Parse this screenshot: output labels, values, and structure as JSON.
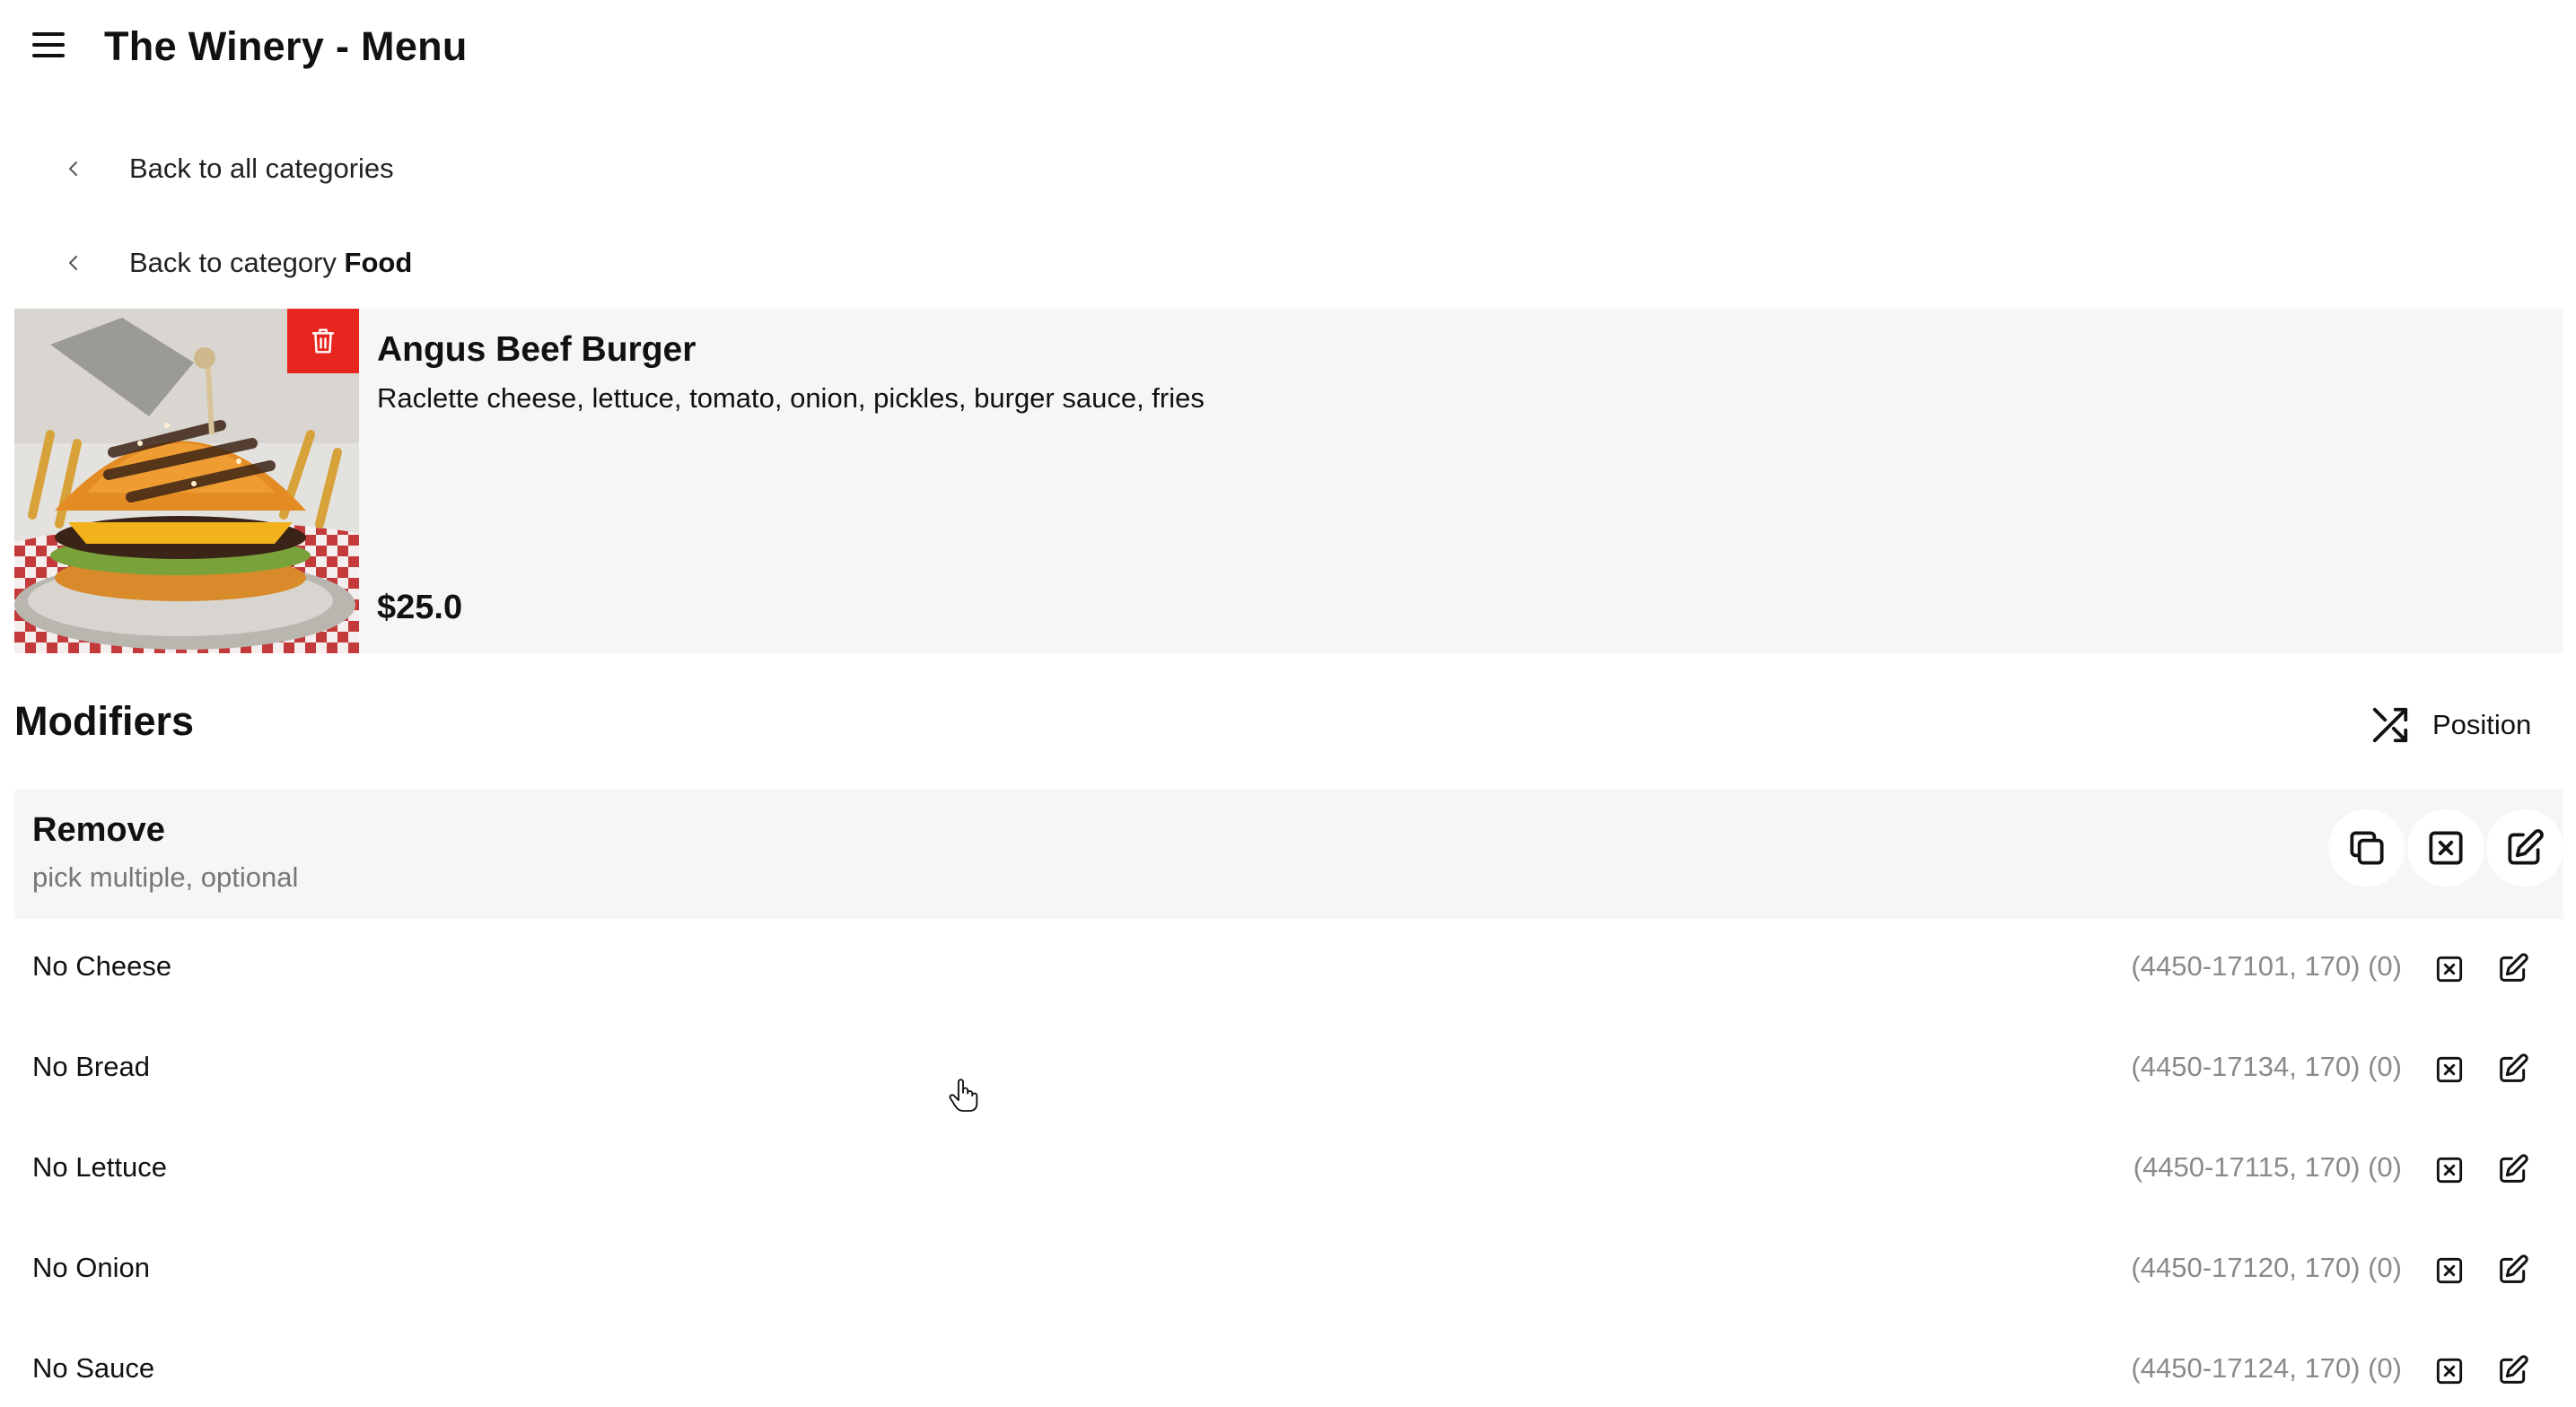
{
  "header": {
    "title": "The Winery - Menu",
    "menu_icon": "hamburger-menu-icon"
  },
  "nav": {
    "back_all": "Back to all categories",
    "back_category_prefix": "Back to category ",
    "back_category_name": "Food"
  },
  "item": {
    "name": "Angus Beef Burger",
    "description": "Raclette cheese, lettuce, tomato, onion, pickles, burger sauce, fries",
    "price": "$25.0",
    "delete_icon": "trash-icon",
    "image": "burger-photo"
  },
  "modifiers": {
    "title": "Modifiers",
    "position_label": "Position",
    "position_icon": "shuffle-icon",
    "group": {
      "name": "Remove",
      "subtitle": "pick multiple, optional"
    },
    "rows": [
      {
        "name": "No Cheese",
        "code": "(4450-17101, 170) (0)"
      },
      {
        "name": "No Bread",
        "code": "(4450-17134, 170) (0)"
      },
      {
        "name": "No Lettuce",
        "code": "(4450-17115, 170) (0)"
      },
      {
        "name": "No Onion",
        "code": "(4450-17120, 170) (0)"
      },
      {
        "name": "No Sauce",
        "code": "(4450-17124, 170) (0)"
      }
    ]
  },
  "colors": {
    "danger": "#e8261f",
    "card_bg": "#f6f6f6",
    "muted_text": "#8a8a8a"
  }
}
